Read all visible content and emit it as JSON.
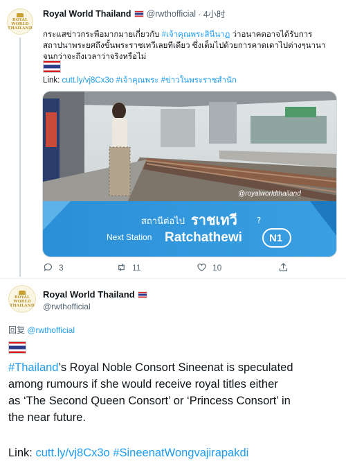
{
  "tweet1": {
    "author_name": "Royal World Thailand",
    "author_handle": "@rwthofficial",
    "time": "· 4小时",
    "avatar_text": "ROYAL WORLD THAILAND",
    "thai_line1_pre": "กระแสข่าวกระพือมากมายเกี่ยวกับ ",
    "thai_tag1": "#เจ้าคุณพระสินีนาฏ",
    "thai_line1_post": " ว่าอนาคตอาจได้รับการ",
    "thai_line2": "สถาปนาพระยศถึงขั้นพระราชเทวีเลยทีเดียว ซึ่งเต็มไปด้วยการคาดเดาไปต่างๆนานา",
    "thai_line3": "จนกว่าจะถึงเวลาว่าจริงหรือไม่",
    "link_label": "Link: ",
    "link_url": "cutt.ly/vj8Cx3o",
    "link_tag1": "#เจ้าคุณพระ",
    "link_tag2": "#ข่าวในพระราชสำนัก",
    "media": {
      "watermark": "@royalworldthailand",
      "thai_next": "สถานีต่อไป",
      "thai_station": "ราชเทวี",
      "question": "?",
      "next_station_label": "Next Station",
      "station_name": "Ratchathewi",
      "station_code": "N1"
    },
    "replies": "3",
    "retweets": "11",
    "likes": "10"
  },
  "tweet2": {
    "author_name": "Royal World Thailand",
    "author_handle": "@rwthofficial",
    "reply_prefix": "回复 ",
    "reply_to": "@rwthofficial",
    "hashtag": "#Thailand",
    "text_line1_post": "’s Royal Noble Consort Sineenat is speculated",
    "text_line2": "among rumours if she would receive royal titles either",
    "text_line3": "as ‘The Second Queen Consort’ or ‘Princess Consort’ in",
    "text_line4": "the near future.",
    "link_label": "Link: ",
    "link_url": "cutt.ly/vj8Cx3o",
    "link_tag": "#SineenatWongvajirapakdi"
  },
  "colors": {
    "link_blue": "#1d9bf0",
    "sign_blue": "#2b8fd6",
    "muted": "#536471"
  }
}
